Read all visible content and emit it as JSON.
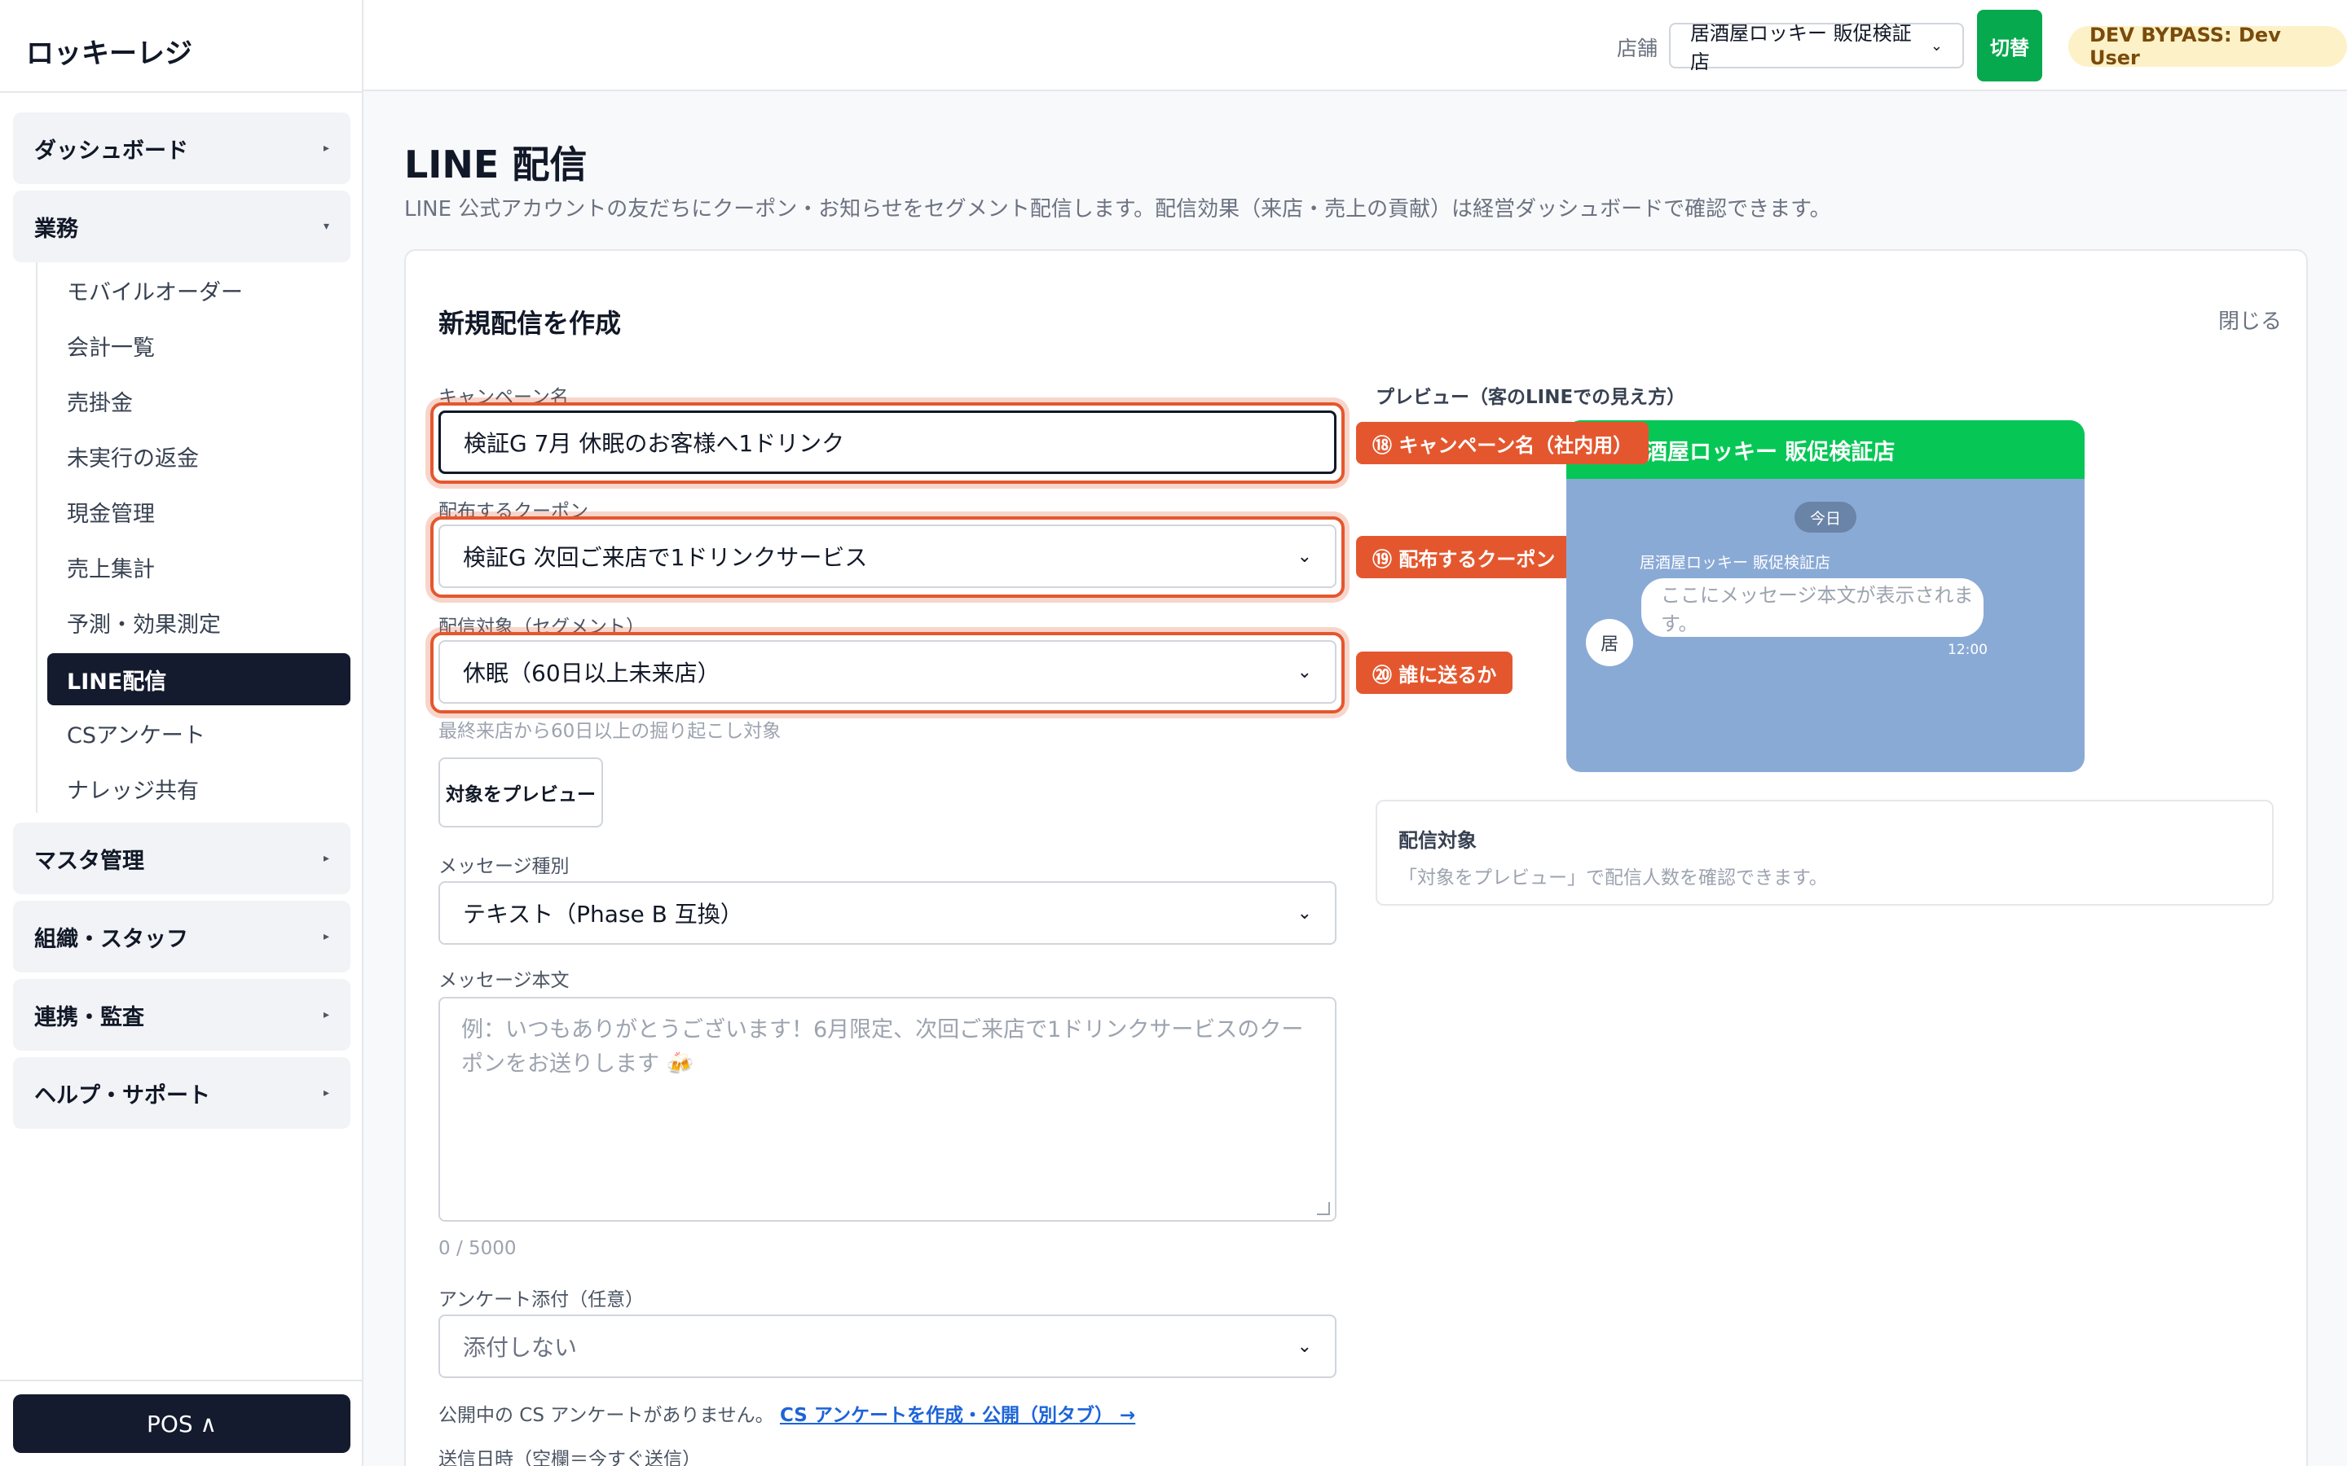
{
  "app": {
    "logo": "ロッキーレジ"
  },
  "sidebar": {
    "groups": [
      {
        "label": "ダッシュボード",
        "caret": "▸"
      },
      {
        "label": "業務",
        "caret": "▾"
      },
      {
        "label": "マスタ管理",
        "caret": "▸"
      },
      {
        "label": "組織・スタッフ",
        "caret": "▸"
      },
      {
        "label": "連携・監査",
        "caret": "▸"
      },
      {
        "label": "ヘルプ・サポート",
        "caret": "▸"
      }
    ],
    "items": [
      {
        "label": "モバイルオーダー"
      },
      {
        "label": "会計一覧"
      },
      {
        "label": "売掛金"
      },
      {
        "label": "未実行の返金"
      },
      {
        "label": "現金管理"
      },
      {
        "label": "売上集計"
      },
      {
        "label": "予測・効果測定"
      },
      {
        "label": "LINE配信"
      },
      {
        "label": "CSアンケート"
      },
      {
        "label": "ナレッジ共有"
      }
    ],
    "pos_button": "POS ∧"
  },
  "header": {
    "store_label": "店舗",
    "store_value": "居酒屋ロッキー 販促検証店",
    "switch_label": "切替",
    "user_badge": "DEV BYPASS: Dev User"
  },
  "page": {
    "title": "LINE 配信",
    "description": "LINE 公式アカウントの友だちにクーポン・お知らせをセグメント配信します。配信効果（来店・売上の貢献）は経営ダッシュボードで確認できます。"
  },
  "form": {
    "title": "新規配信を作成",
    "close": "閉じる",
    "campaign_label": "キャンペーン名",
    "campaign_value": "検証G 7月 休眠のお客様へ1ドリンク",
    "coupon_label": "配布するクーポン",
    "coupon_value": "検証G 次回ご来店で1ドリンクサービス",
    "segment_label": "配信対象（セグメント）",
    "segment_value": "休眠（60日以上未来店）",
    "segment_hint": "最終来店から60日以上の掘り起こし対象",
    "preview_button": "対象をプレビュー",
    "msgtype_label": "メッセージ種別",
    "msgtype_value": "テキスト（Phase B 互換）",
    "body_label": "メッセージ本文",
    "body_placeholder": "例：いつもありがとうございます！6月限定、次回ご来店で1ドリンクサービスのクーポンをお送りします 🍻",
    "body_counter": "0 / 5000",
    "survey_label": "アンケート添付（任意）",
    "survey_value": "添付しない",
    "survey_note": "公開中の CS アンケートがありません。",
    "survey_link": "CS アンケートを作成・公開（別タブ） →",
    "schedule_label": "送信日時（空欄＝今すぐ送信）"
  },
  "callouts": {
    "c18": "⑱ キャンペーン名（社内用）",
    "c19": "⑲ 配布するクーポン",
    "c20": "⑳ 誰に送るか"
  },
  "preview": {
    "label": "プレビュー（客のLINEでの見え方）",
    "header": "居酒屋ロッキー 販促検証店",
    "today": "今日",
    "sender": "居酒屋ロッキー 販促検証店",
    "avatar": "居",
    "bubble": "ここにメッセージ本文が表示されます。",
    "time": "12:00",
    "target_title": "配信対象",
    "target_text": "「対象をプレビュー」で配信人数を確認できます。"
  },
  "colors": {
    "line_green": "#06C755",
    "switch_green": "#06A94D",
    "active_nav": "#151B2E",
    "callout_orange": "#E4572E",
    "preview_bg": "#8AAAD6"
  }
}
